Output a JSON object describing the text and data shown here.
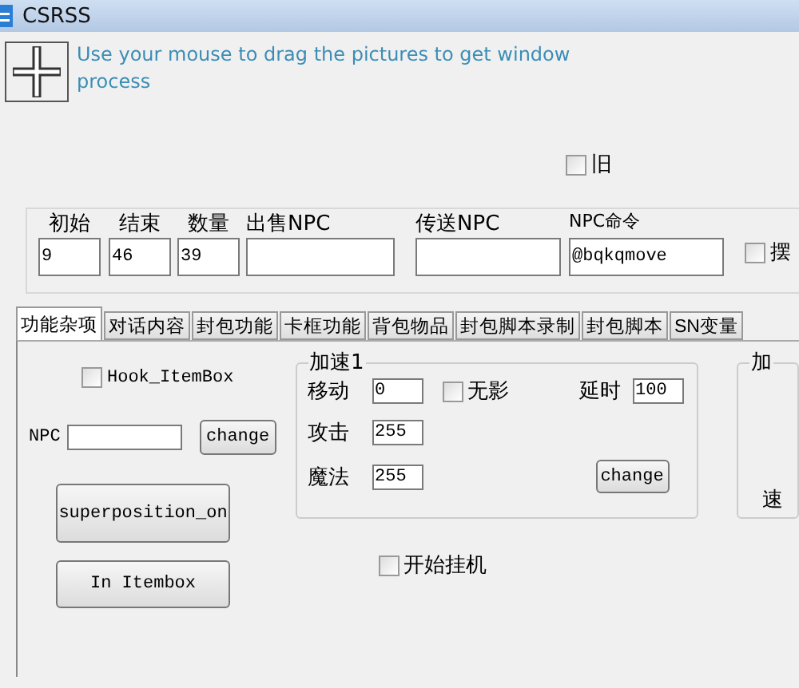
{
  "window": {
    "title": "CSRSS"
  },
  "finder": {
    "hint": "Use your mouse to drag the pictures to get window process"
  },
  "old_checkbox": {
    "label": "旧",
    "checked": false
  },
  "top_fields": [
    {
      "label": "初始",
      "value": "9"
    },
    {
      "label": "结束",
      "value": "46"
    },
    {
      "label": "数量",
      "value": "39"
    },
    {
      "label": "出售NPC"
    },
    {
      "label": "传送NPC"
    },
    {
      "label": "NPC命令",
      "value": "@bqkqmove"
    }
  ],
  "right_checkbox": {
    "label": "摆",
    "checked": false
  },
  "tabs": [
    {
      "label": "功能杂项",
      "selected": true
    },
    {
      "label": "对话内容",
      "selected": false
    },
    {
      "label": "封包功能",
      "selected": false
    },
    {
      "label": "卡框功能",
      "selected": false
    },
    {
      "label": "背包物品",
      "selected": false
    },
    {
      "label": "封包脚本录制",
      "selected": false
    },
    {
      "label": "封包脚本",
      "selected": false
    },
    {
      "label": "SN变量",
      "selected": false
    }
  ],
  "panel": {
    "hook_checkbox": {
      "label": "Hook_ItemBox",
      "checked": false
    },
    "npc": {
      "label": "NPC",
      "button": "change"
    },
    "buttons": [
      "superposition_on",
      "In Itembox"
    ],
    "speed_group": {
      "title": "加速1",
      "rows": [
        {
          "label": "移动",
          "value": "0"
        },
        {
          "label": "攻击",
          "value": "255"
        },
        {
          "label": "魔法",
          "value": "255"
        }
      ],
      "no_shadow": {
        "label": "无影",
        "checked": false
      },
      "delay": {
        "label": "延时",
        "value": "100"
      },
      "button": "change"
    },
    "start_checkbox": {
      "label": "开始挂机",
      "checked": false
    },
    "side_group": {
      "title": "加",
      "label": "速"
    }
  }
}
